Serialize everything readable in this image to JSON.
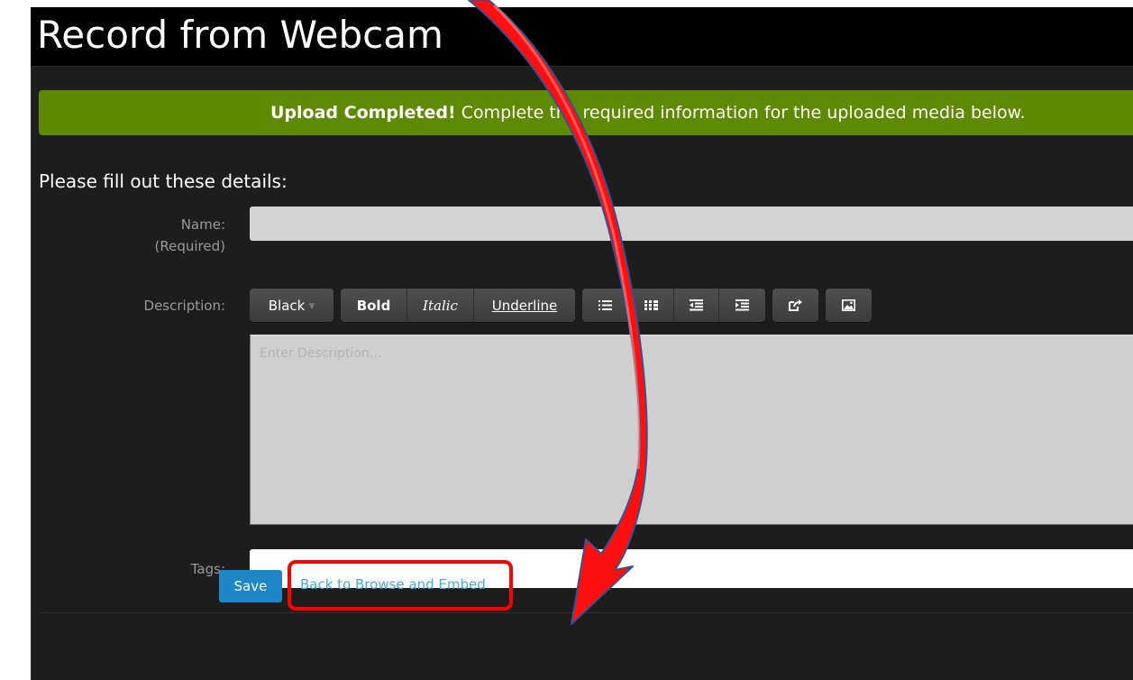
{
  "page": {
    "title": "Record from Webcam"
  },
  "alert": {
    "strong": "Upload Completed!",
    "text": " Complete the required information for the uploaded media below."
  },
  "form": {
    "heading": "Please fill out these details:",
    "name_label": "Name:",
    "name_required": "(Required)",
    "name_value": "",
    "description_label": "Description:",
    "description_placeholder": "Enter Description...",
    "tags_label": "Tags:",
    "tags_value": ""
  },
  "editor_toolbar": {
    "color_label": "Black",
    "bold_label": "Bold",
    "italic_label": "Italic",
    "underline_label": "Underline",
    "icons": [
      "unordered-list-icon",
      "ordered-list-icon",
      "outdent-icon",
      "indent-icon",
      "link-icon",
      "image-icon"
    ]
  },
  "actions": {
    "save_label": "Save",
    "back_link_label": "Back to Browse and Embed"
  },
  "colors": {
    "alert_bg": "#5d8a00",
    "save_bg": "#1e87c6",
    "link": "#4aa8d8",
    "annotation": "#ff0000"
  }
}
